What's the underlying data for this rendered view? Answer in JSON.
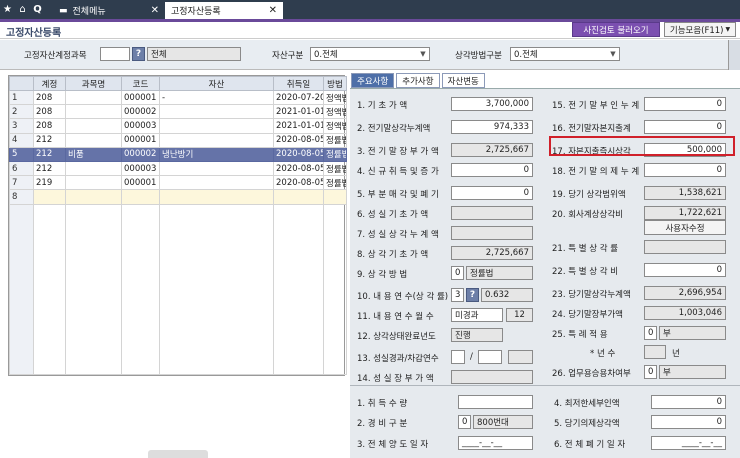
{
  "topbar": {
    "tabs": [
      {
        "label": "전체메뉴",
        "active": false
      },
      {
        "label": "고정자산등록",
        "active": true
      }
    ]
  },
  "page": {
    "title": "고정자산등록",
    "buttons": {
      "recheck": "사진검토 불러오기",
      "functions": "기능모음(F11)"
    }
  },
  "filter": {
    "account_label": "고정자산계정과목",
    "account_value": "",
    "account_name": "전체",
    "asset_type_label": "자산구분",
    "asset_type_value": "0.전체",
    "dep_method_label": "상각방법구분",
    "dep_method_value": "0.전체"
  },
  "grid": {
    "headers": [
      "계정",
      "과목명",
      "코드",
      "자산",
      "취득일",
      "방법"
    ],
    "rows": [
      {
        "n": "1",
        "account": "208",
        "subject": "",
        "code": "000001",
        "asset": "-",
        "date": "2020-07-20",
        "method": "정액법"
      },
      {
        "n": "2",
        "account": "208",
        "subject": "",
        "code": "000002",
        "asset": "",
        "date": "2021-01-01",
        "method": "정액법"
      },
      {
        "n": "3",
        "account": "208",
        "subject": "",
        "code": "000003",
        "asset": "",
        "date": "2021-01-01",
        "method": "정액법"
      },
      {
        "n": "4",
        "account": "212",
        "subject": "",
        "code": "000001",
        "asset": "",
        "date": "2020-08-05",
        "method": "정률법"
      },
      {
        "n": "5",
        "account": "212",
        "subject": "비품",
        "code": "000002",
        "asset": "냉난방기",
        "date": "2020-08-05",
        "method": "정률법"
      },
      {
        "n": "6",
        "account": "212",
        "subject": "",
        "code": "000003",
        "asset": "",
        "date": "2020-08-05",
        "method": "정률법"
      },
      {
        "n": "7",
        "account": "219",
        "subject": "",
        "code": "000001",
        "asset": "",
        "date": "2020-08-05",
        "method": "정률법"
      },
      {
        "n": "8",
        "account": "",
        "subject": "",
        "code": "",
        "asset": "",
        "date": "",
        "method": ""
      }
    ]
  },
  "subtabs": [
    "주요사항",
    "추가사항",
    "자산변동"
  ],
  "left_fields": [
    {
      "label": "1. 기 초 가 액",
      "value": "3,700,000"
    },
    {
      "label": "2. 전기말상각누계액",
      "value": "974,333"
    },
    {
      "label": "3. 전 기 말 장 부 가 액",
      "value": "2,725,667"
    },
    {
      "label": "4. 신 규 취 득 및 증 가",
      "value": "0"
    },
    {
      "label": "5. 부 분 매 각 및 폐 기",
      "value": "0"
    },
    {
      "label": "6. 성 실 기 초 가 액",
      "value": ""
    },
    {
      "label": "7. 성 실 상 각 누 계 액",
      "value": ""
    },
    {
      "label": "8. 상 각 기 초 가 액",
      "value": "2,725,667"
    },
    {
      "label": "9. 상 각 방 법",
      "code": "0",
      "value": "정률법"
    },
    {
      "label": "10. 내 용 연 수(상 각 률)",
      "code": "3",
      "value": "0.632"
    },
    {
      "label": "11. 내 용 연 수 월 수",
      "code": "미경과",
      "value": "12"
    },
    {
      "label": "12. 상각상태완료년도",
      "value": "진행"
    },
    {
      "label": "13. 성실경과/차감연수",
      "value": "/"
    },
    {
      "label": "14. 성 실 장 부 가 액",
      "value": ""
    }
  ],
  "right_fields": [
    {
      "label": "15. 전 기 말 부 인 누 계",
      "value": "0"
    },
    {
      "label": "16. 전기말자본지출계",
      "value": "0"
    },
    {
      "label": "17. 자본지출즉시상각",
      "value": "500,000"
    },
    {
      "label": "18. 전 기 말 의 제 누 계",
      "value": "0"
    },
    {
      "label": "19. 당기 상각범위액",
      "value": "1,538,621"
    },
    {
      "label": "20. 회사계상상각비",
      "value": "1,722,621"
    },
    {
      "label": "사용자수정",
      "value": ""
    },
    {
      "label": "21. 특 별 상 각 률",
      "value": ""
    },
    {
      "label": "22. 특 별 상 각 비",
      "value": "0"
    },
    {
      "label": "23. 당기말상각누계액",
      "value": "2,696,954"
    },
    {
      "label": "24. 당기말장부가액",
      "value": "1,003,046"
    },
    {
      "label": "25. 특 례 적 용",
      "code": "0",
      "value": "부"
    },
    {
      "label": "* 년 수",
      "value": "년"
    },
    {
      "label": "26. 업무용승용차여부",
      "code": "0",
      "value": "부"
    }
  ],
  "bottom_left": [
    {
      "label": "1. 취 득 수 량",
      "value": ""
    },
    {
      "label": "2. 경 비 구 분",
      "code": "0",
      "value": "800번대"
    },
    {
      "label": "3. 전 체 양 도 일 자",
      "value": "____-__-__"
    }
  ],
  "bottom_right": [
    {
      "label": "4. 최저한세부인액",
      "value": "0"
    },
    {
      "label": "5. 당기의제상각액",
      "value": "0"
    },
    {
      "label": "6. 전 체 폐 기 일 자",
      "value": "____-__-__"
    }
  ]
}
